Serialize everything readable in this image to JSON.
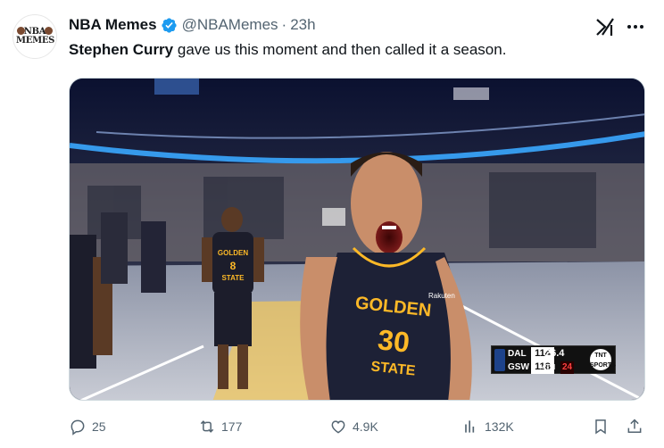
{
  "account": {
    "avatar_text": "NBA MEMES",
    "name": "NBA Memes",
    "handle": "@NBAMemes",
    "separator": "·",
    "time": "23h"
  },
  "tweet": {
    "text_bold": "Stephen Curry",
    "text_rest": " gave us this moment and then called it a season."
  },
  "media": {
    "jersey_left": "GOLDEN",
    "jersey_left_mid": "8",
    "jersey_left_bottom": "STATE",
    "jersey_main": "GOLDEN",
    "jersey_number": "30",
    "jersey_bottom": "STATE",
    "sponsor": "Rakuten",
    "scoreboard": {
      "team1": "DAL",
      "score1": "114",
      "team2": "GSW",
      "score2": "118",
      "clock": "26.4",
      "quarter": "4TH",
      "shot_clock": "24",
      "network": "TNT SPORTS"
    }
  },
  "actions": {
    "replies": "25",
    "reposts": "177",
    "likes": "4.9K",
    "views": "132K"
  },
  "colors": {
    "verified": "#1d9bf0",
    "text_secondary": "#536471",
    "warriors_gold": "#fdb927",
    "warriors_navy": "#1d2136"
  },
  "icons": {
    "reply": "reply-icon",
    "repost": "repost-icon",
    "like": "heart-icon",
    "views": "views-icon",
    "bookmark": "bookmark-icon",
    "share": "share-icon",
    "grok": "grok-icon",
    "more": "more-icon"
  }
}
